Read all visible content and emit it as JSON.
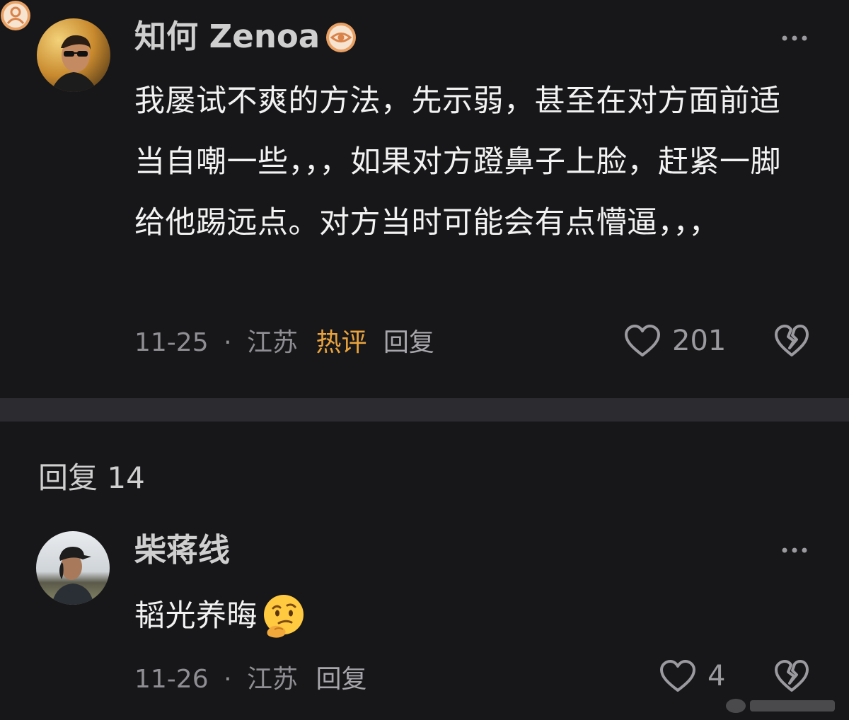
{
  "main_comment": {
    "username": "知何 Zenoa",
    "badge_icon": "eye-badge-icon",
    "text": "我屡试不爽的方法，先示弱，甚至在对方面前适当自嘲一些，，，如果对方蹬鼻子上脸，赶紧一脚给他踢远点。对方当时可能会有点懵逼，，，",
    "date": "11-25",
    "separator": "·",
    "location": "江苏",
    "hot_tag": "热评",
    "reply_label": "回复",
    "likes": "201"
  },
  "replies_header": {
    "label": "回复 14"
  },
  "reply_comment": {
    "username": "柴蒋线",
    "badge_icon": "person-badge-icon",
    "text": "韬光养晦",
    "emoji": "thinking-face-emoji",
    "date": "11-26",
    "separator": "·",
    "location": "江苏",
    "reply_label": "回复",
    "likes": "4"
  },
  "colors": {
    "background": "#17171a",
    "divider": "#2b2b30",
    "hot_tag": "#e8a33d",
    "badge": "#e9a063",
    "meta_text": "#8e8e93"
  }
}
